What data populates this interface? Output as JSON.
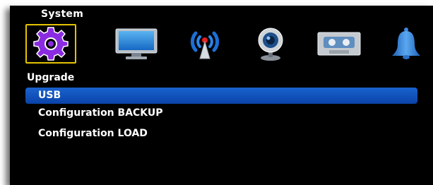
{
  "header": {
    "title": "System"
  },
  "toolbar": {
    "icons": [
      {
        "name": "system-gear-icon",
        "selected": true
      },
      {
        "name": "display-monitor-icon",
        "selected": false
      },
      {
        "name": "network-antenna-icon",
        "selected": false
      },
      {
        "name": "camera-webcam-icon",
        "selected": false
      },
      {
        "name": "record-cassette-icon",
        "selected": false
      },
      {
        "name": "alarm-bell-icon",
        "selected": false
      }
    ]
  },
  "section": {
    "title": "Upgrade"
  },
  "menu": {
    "items": [
      {
        "label": "USB",
        "active": true
      },
      {
        "label": "Configuration BACKUP",
        "active": false
      },
      {
        "label": "Configuration LOAD",
        "active": false
      }
    ]
  },
  "colors": {
    "background": "#000000",
    "highlight": "#1457c0",
    "selection_border": "#e6c300",
    "text": "#ffffff"
  }
}
